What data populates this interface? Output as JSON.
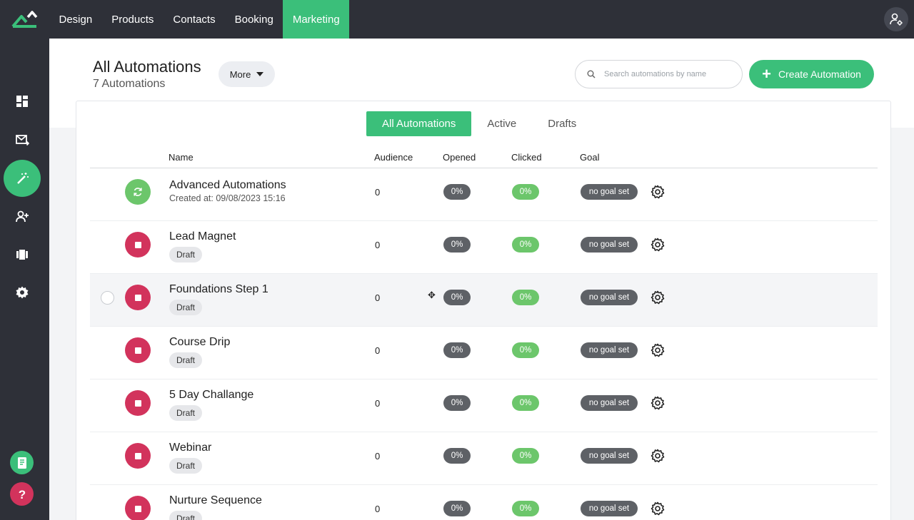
{
  "nav": {
    "items": [
      {
        "label": "Design",
        "active": false
      },
      {
        "label": "Products",
        "active": false
      },
      {
        "label": "Contacts",
        "active": false
      },
      {
        "label": "Booking",
        "active": false
      },
      {
        "label": "Marketing",
        "active": true
      }
    ]
  },
  "sidebar": {
    "items": [
      {
        "icon": "dashboard-icon",
        "active": false
      },
      {
        "icon": "mail-send-icon",
        "active": false
      },
      {
        "icon": "magic-wand-icon",
        "active": true
      },
      {
        "icon": "user-plus-icon",
        "active": false
      },
      {
        "icon": "ticket-icon",
        "active": false
      },
      {
        "icon": "gear-icon",
        "active": false
      }
    ],
    "bottom": [
      {
        "icon": "book-icon",
        "color": "#3bbf7a"
      },
      {
        "icon": "help-icon",
        "color": "#d2335c"
      }
    ]
  },
  "header": {
    "title": "All Automations",
    "subtitle": "7 Automations",
    "more_label": "More",
    "search_placeholder": "Search automations by name",
    "create_label": "Create Automation"
  },
  "tabs": [
    {
      "label": "All Automations",
      "active": true
    },
    {
      "label": "Active",
      "active": false
    },
    {
      "label": "Drafts",
      "active": false
    }
  ],
  "columns": {
    "name": "Name",
    "audience": "Audience",
    "opened": "Opened",
    "clicked": "Clicked",
    "goal": "Goal"
  },
  "rows": [
    {
      "name": "Advanced Automations",
      "status": "active",
      "created": "Created at: 09/08/2023 15:16",
      "badge": "",
      "audience": "0",
      "opened": "0%",
      "clicked": "0%",
      "goal": "no goal set",
      "hover": false
    },
    {
      "name": "Lead Magnet",
      "status": "draft",
      "created": "",
      "badge": "Draft",
      "audience": "0",
      "opened": "0%",
      "clicked": "0%",
      "goal": "no goal set",
      "hover": false
    },
    {
      "name": "Foundations Step 1",
      "status": "draft",
      "created": "",
      "badge": "Draft",
      "audience": "0",
      "opened": "0%",
      "clicked": "0%",
      "goal": "no goal set",
      "hover": true
    },
    {
      "name": "Course Drip",
      "status": "draft",
      "created": "",
      "badge": "Draft",
      "audience": "0",
      "opened": "0%",
      "clicked": "0%",
      "goal": "no goal set",
      "hover": false
    },
    {
      "name": "5 Day Challange",
      "status": "draft",
      "created": "",
      "badge": "Draft",
      "audience": "0",
      "opened": "0%",
      "clicked": "0%",
      "goal": "no goal set",
      "hover": false
    },
    {
      "name": "Webinar",
      "status": "draft",
      "created": "",
      "badge": "Draft",
      "audience": "0",
      "opened": "0%",
      "clicked": "0%",
      "goal": "no goal set",
      "hover": false
    },
    {
      "name": "Nurture Sequence",
      "status": "draft",
      "created": "",
      "badge": "Draft",
      "audience": "0",
      "opened": "0%",
      "clicked": "0%",
      "goal": "no goal set",
      "hover": false
    }
  ],
  "colors": {
    "brand_green": "#3bbf7a",
    "active_status": "#6cc66b",
    "draft_status": "#d2335c",
    "dark_bg": "#2e3038",
    "gray_pill": "#5e6166"
  }
}
